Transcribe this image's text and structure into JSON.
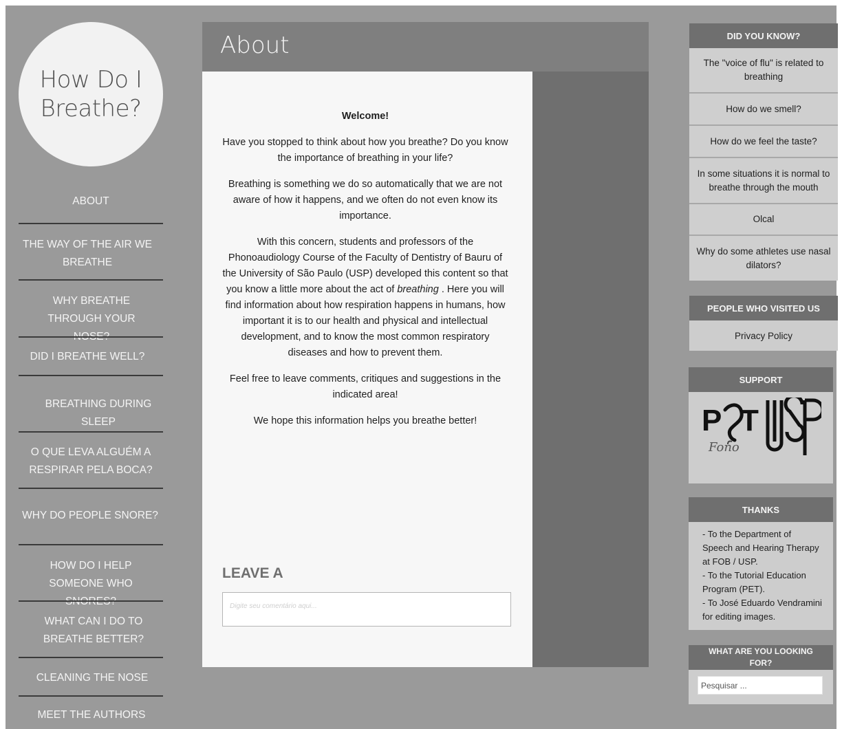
{
  "site": {
    "title": "How Do I Breathe?"
  },
  "nav": {
    "items": [
      "ABOUT",
      "THE WAY OF THE AIR WE BREATHE",
      "WHY BREATHE THROUGH YOUR NOSE?",
      "DID I BREATHE WELL?",
      "BREATHING DURING SLEEP",
      "O QUE LEVA ALGUÉM A RESPIRAR PELA BOCA?",
      "WHY DO PEOPLE SNORE?",
      "HOW DO I HELP SOMEONE WHO SNORES?",
      "WHAT CAN I DO TO BREATHE BETTER?",
      "CLEANING THE NOSE",
      "MEET THE AUTHORS"
    ]
  },
  "main": {
    "title": "About",
    "welcome": "Welcome!",
    "p1": "Have you stopped to think about how you breathe? Do you know the importance of breathing in your life?",
    "p2": "Breathing is something we do so automatically that we are not aware of how it happens, and we often do not even know its importance.",
    "p3_before": "With this concern, students and professors of the Phonoaudiology Course of the Faculty of Dentistry of Bauru of the University of São Paulo (USP) developed this content so that you know a little more about the act of ",
    "p3_em": "breathing",
    "p3_after": " . Here you will find information about how respiration happens in humans, how important it is to our health and physical and intellectual development, and to know the most common respiratory diseases and how to prevent them.",
    "p4": "Feel free to leave comments, critiques and suggestions in the indicated area!",
    "p5": "We hope this information helps you breathe better!",
    "leave_title": "LEAVE A",
    "comment_placeholder": "Digite seu comentário aqui..."
  },
  "widgets": {
    "did_you_know": {
      "heading": "DID YOU KNOW?",
      "items": [
        "The \"voice of flu\" is related to breathing",
        "How do we smell?",
        "How do we feel the taste?",
        "In some situations it is normal to breathe through the mouth",
        "Olcal",
        "Why do some athletes use nasal dilators?"
      ]
    },
    "visited": {
      "heading": "PEOPLE WHO VISITED US",
      "link": "Privacy Policy"
    },
    "support": {
      "heading": "SUPPORT",
      "logo1": "PET Fono",
      "logo2": "USP"
    },
    "thanks": {
      "heading": "THANKS",
      "lines": [
        "- To the Department of Speech and Hearing Therapy at FOB / USP.",
        "- To the Tutorial Education Program (PET).",
        "- To José Eduardo Vendramini for editing images."
      ]
    },
    "search": {
      "heading": "WHAT ARE YOU LOOKING FOR?",
      "placeholder": "Pesquisar ..."
    }
  }
}
